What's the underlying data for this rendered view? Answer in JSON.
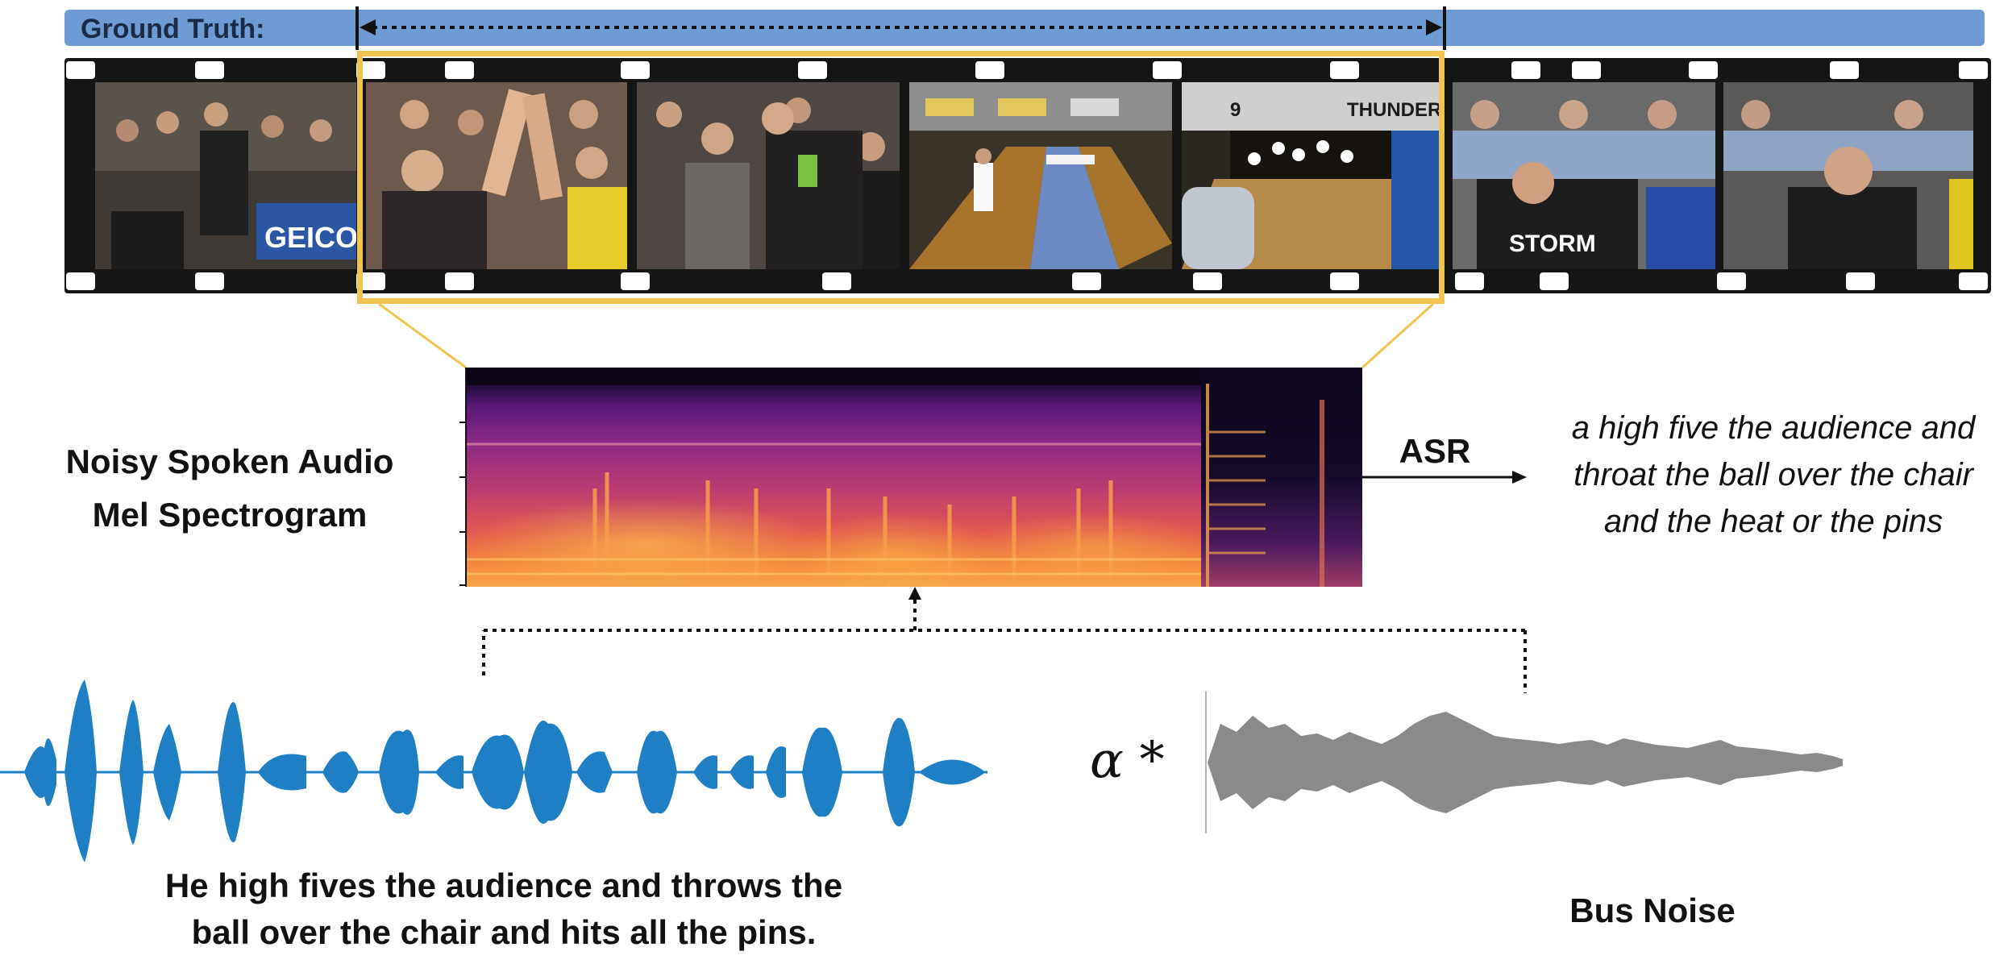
{
  "ground_truth": {
    "label": "Ground Truth:"
  },
  "film": {
    "frames": [
      {
        "scene": "bowler-crowd-geico-frame"
      },
      {
        "scene": "high-five-frame"
      },
      {
        "scene": "crowd-bowler-frame"
      },
      {
        "scene": "lane-throw-frame"
      },
      {
        "scene": "pins-thunder-frame"
      },
      {
        "scene": "bowler-bending-frame"
      },
      {
        "scene": "bowler-smiling-frame"
      }
    ],
    "frame4_sign": "THUNDER",
    "frame4_number": "9"
  },
  "spectrogram": {
    "title_line1": "Noisy Spoken Audio",
    "title_line2": "Mel Spectrogram"
  },
  "asr": {
    "label": "ASR",
    "output_line1": "a high five the audience and",
    "output_line2": "throat the ball over the chair",
    "output_line3": "and the heat or the pins"
  },
  "clean_audio": {
    "caption_line1": "He high fives the audience and throws the",
    "caption_line2": "ball over the chair and hits all the pins.",
    "color": "#1f7fc4"
  },
  "noise": {
    "scale_symbol": "α *",
    "caption": "Bus Noise",
    "color": "#8a8a8a"
  },
  "colors": {
    "accent_highlight": "#f2c34f",
    "ground_truth_bar": "#6e9bd3"
  }
}
